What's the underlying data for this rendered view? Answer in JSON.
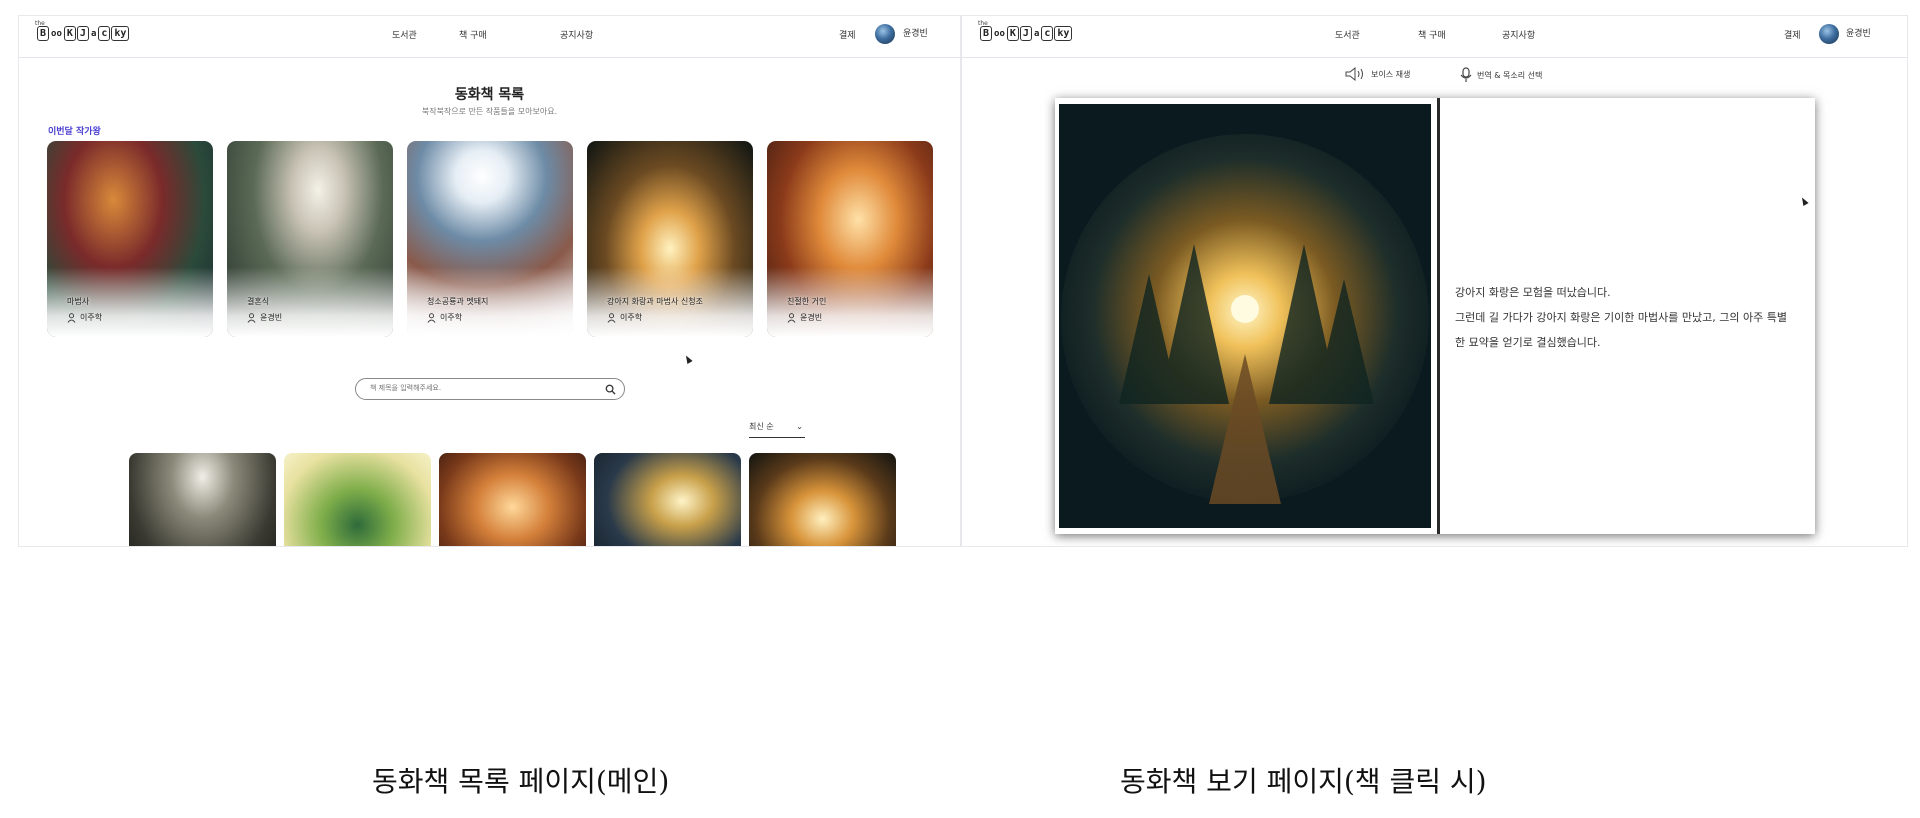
{
  "left_page": {
    "nav": {
      "logo_text": "BooKJacky",
      "logo_small": "the",
      "links": [
        "도서관",
        "책 구매",
        "공지사항"
      ],
      "payment": "결제",
      "user_name": "윤경빈"
    },
    "title": "동화책 목록",
    "subtitle": "북작북작으로 만든 작품들을 모아보아요.",
    "section_label": "이번달 작가왕",
    "featured": [
      {
        "title": "마법사",
        "author": "이주학"
      },
      {
        "title": "결혼식",
        "author": "윤경빈"
      },
      {
        "title": "청소공룡과 멧돼지",
        "author": "이주학"
      },
      {
        "title": "강아지 화랑과 마법사 신청조",
        "author": "이주학"
      },
      {
        "title": "친절한 거인",
        "author": "윤경빈"
      }
    ],
    "search_placeholder": "책 제목을 입력해주세요.",
    "sort_selected": "최신 순",
    "grid_count": 5
  },
  "right_page": {
    "nav": {
      "logo_text": "BooKJacky",
      "logo_small": "the",
      "links": [
        "도서관",
        "책 구매",
        "공지사항"
      ],
      "payment": "결제",
      "user_name": "윤경빈"
    },
    "toolbar": {
      "voice_play": "보이스 재생",
      "translate_voice": "번역 & 목소리 선택"
    },
    "story_lines": [
      "강아지 화랑은 모험을 떠났습니다.",
      "그런데 길 가다가 강아지 화랑은 기이한 마법사를 만났고, 그의 아주 특별",
      "한 묘약을 얻기로 결심했습니다."
    ]
  },
  "captions": {
    "left": "동화책 목록 페이지(메인)",
    "right": "동화책 보기 페이지(책 클릭 시)"
  },
  "colors": {
    "accent": "#4a3fd0",
    "nav_active": "#5b8fd8"
  }
}
